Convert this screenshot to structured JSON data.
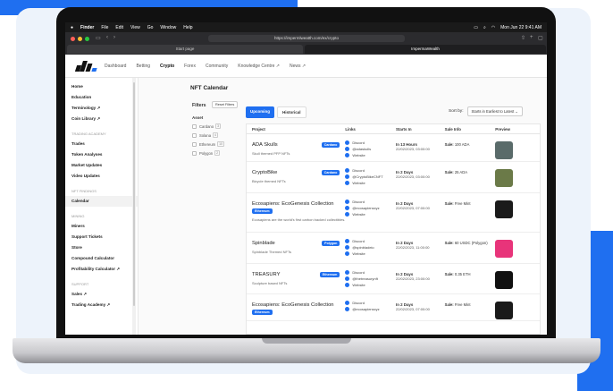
{
  "menubar": {
    "apple": "",
    "app": "Finder",
    "items": [
      "File",
      "Edit",
      "View",
      "Go",
      "Window",
      "Help"
    ],
    "clock": "Mon Jun 22  9:41 AM"
  },
  "browser": {
    "url": "https://impermlweatth.com/ex/crypto",
    "tab_left": "Start page",
    "tab_right": "ImpermaWealth"
  },
  "nav": {
    "items": [
      "Dashboard",
      "Betting",
      "Crypto",
      "Forex",
      "Community",
      "Knowledge Centre ↗",
      "News ↗"
    ],
    "active": "Crypto"
  },
  "sidebar": {
    "items": [
      {
        "type": "item",
        "label": "Home"
      },
      {
        "type": "item",
        "label": "Education"
      },
      {
        "type": "item",
        "label": "Terminology ↗"
      },
      {
        "type": "item",
        "label": "Coin Library ↗"
      },
      {
        "type": "section",
        "label": "TRADING ACADEMY"
      },
      {
        "type": "item",
        "label": "Trades"
      },
      {
        "type": "item",
        "label": "Token Analyses"
      },
      {
        "type": "item",
        "label": "Market Updates"
      },
      {
        "type": "item",
        "label": "Video Updates"
      },
      {
        "type": "section",
        "label": "NFT FINDINGS"
      },
      {
        "type": "item",
        "label": "Calendar",
        "selected": true
      },
      {
        "type": "section",
        "label": "MINING"
      },
      {
        "type": "item",
        "label": "Miners"
      },
      {
        "type": "item",
        "label": "Support Tickets"
      },
      {
        "type": "item",
        "label": "Store"
      },
      {
        "type": "item",
        "label": "Compound Calculator"
      },
      {
        "type": "item",
        "label": "Profitability Calculator ↗"
      },
      {
        "type": "section",
        "label": "SUPPORT"
      },
      {
        "type": "item",
        "label": "Sales ↗"
      },
      {
        "type": "item",
        "label": "Trading Academy ↗"
      }
    ]
  },
  "page": {
    "title": "NFT Calendar"
  },
  "filters": {
    "title": "Filters",
    "reset": "Reset Filters",
    "asset_label": "Asset",
    "assets": [
      {
        "name": "Cardano",
        "count": "3"
      },
      {
        "name": "Solana",
        "count": "4"
      },
      {
        "name": "Ethereum",
        "count": "10"
      },
      {
        "name": "Polygon",
        "count": "2"
      }
    ]
  },
  "tabs": {
    "upcoming": "Upcoming",
    "historical": "Historical"
  },
  "sort": {
    "label": "Sort by:",
    "value": "Starts in Earliest to Latest"
  },
  "table": {
    "headers": [
      "Project",
      "Links",
      "Starts In",
      "Sale Info",
      "Preview"
    ],
    "rows": [
      {
        "name": "ADA Skulls",
        "badge": "Cardano",
        "badge_pos": "right",
        "desc": "Skull themed PFP NFTs",
        "links": [
          "Discord",
          "@adaskulls",
          "Website"
        ],
        "start_bold": "In 13 Hours",
        "start": "22/02/2023, 03:00:00",
        "sale_label": "Sale:",
        "sale": "100 ADA",
        "thumb": "#5a6b6a"
      },
      {
        "name": "CryptoBike",
        "badge": "Cardano",
        "badge_pos": "right",
        "desc": "Bicycle themed NFTs",
        "links": [
          "Discord",
          "@CryptoBikeCNFT",
          "Website"
        ],
        "start_bold": "In 2 Days",
        "start": "22/02/2023, 03:00:00",
        "sale_label": "Sale:",
        "sale": "25 ADA",
        "thumb": "#6b7a48"
      },
      {
        "name": "Ecosapiens: EcoGenesis Collection",
        "badge": "Ethereum",
        "badge_pos": "inline",
        "desc": "Ecosapiens are the world's first carbon backed collectibles.",
        "links": [
          "Discord",
          "@ecosapiensxyz",
          "Website"
        ],
        "start_bold": "In 2 Days",
        "start": "22/02/2023, 07:00:00",
        "sale_label": "Sale:",
        "sale": "Free Mint",
        "thumb": "#1a1a1a"
      },
      {
        "name": "Spinblade",
        "badge": "Polygon",
        "badge_pos": "right",
        "desc": "Spinblade Themed NFTs",
        "links": [
          "Discord",
          "@spinbladeio",
          "Website"
        ],
        "start_bold": "In 2 Days",
        "start": "22/02/2023, 11:00:00",
        "sale_label": "Sale:",
        "sale": "60 USDC (Polygon)",
        "thumb": "#e8347a"
      },
      {
        "name": "TREASURY",
        "badge": "Ethereum",
        "badge_pos": "right",
        "desc": "Sculpture based NFTs",
        "links": [
          "Discord",
          "@thetreasurynft",
          "Website"
        ],
        "start_bold": "In 2 Days",
        "start": "22/02/2023, 23:00:00",
        "sale_label": "Sale:",
        "sale": "0.35 ETH",
        "thumb": "#111111"
      },
      {
        "name": "Ecosapiens: EcoGenesis Collection",
        "badge": "Ethereum",
        "badge_pos": "inline",
        "desc": "",
        "links": [
          "Discord",
          "@ecosapiensxyz"
        ],
        "start_bold": "In 2 Days",
        "start": "22/02/2023, 07:00:00",
        "sale_label": "Sale:",
        "sale": "Free Mint",
        "thumb": "#1a1a1a"
      }
    ]
  }
}
